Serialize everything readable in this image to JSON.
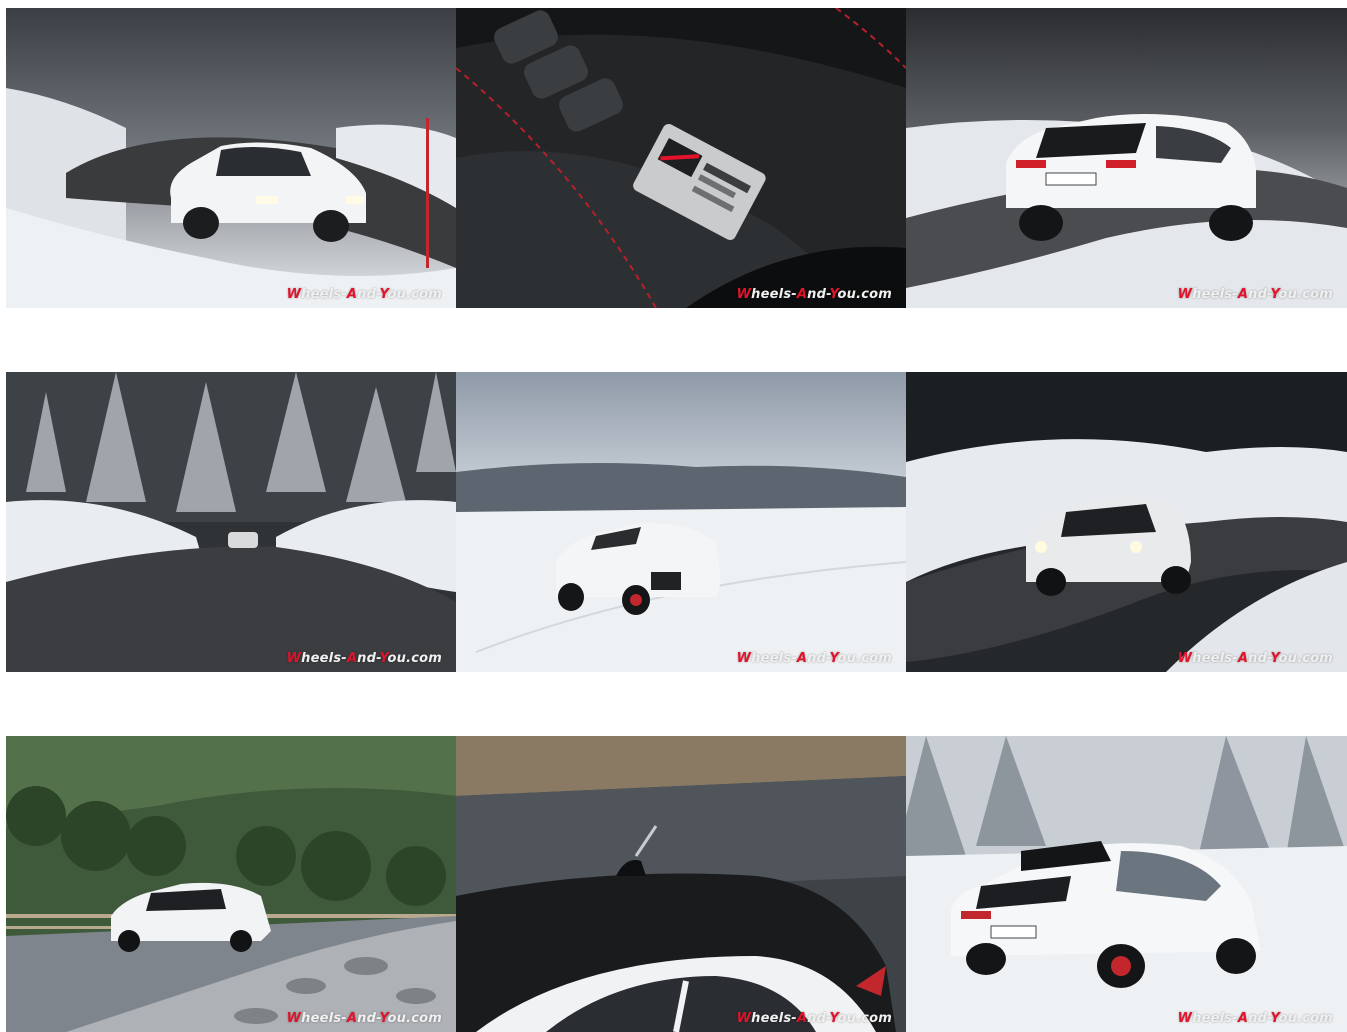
{
  "gallery": {
    "items": [
      {
        "scene": "white-hatchback-snowy-curve-fog",
        "watermark": {
          "a": "W",
          "b": "heels-",
          "c": "A",
          "d": "nd-",
          "e": "Y",
          "f": "ou.com"
        }
      },
      {
        "scene": "gr-wrc-interior-badge-closeup",
        "watermark": {
          "a": "W",
          "b": "heels-",
          "c": "A",
          "d": "nd-",
          "e": "Y",
          "f": "ou.com"
        }
      },
      {
        "scene": "white-hatchback-rear-snowy-road",
        "watermark": {
          "a": "W",
          "b": "heels-",
          "c": "A",
          "d": "nd-",
          "e": "Y",
          "f": "ou.com"
        }
      },
      {
        "scene": "snowy-forest-road-distant-car",
        "watermark": {
          "a": "W",
          "b": "heels-",
          "c": "A",
          "d": "nd-",
          "e": "Y",
          "f": "ou.com"
        }
      },
      {
        "scene": "white-hatchback-snowfield",
        "watermark": {
          "a": "W",
          "b": "heels-",
          "c": "A",
          "d": "nd-",
          "e": "Y",
          "f": "ou.com"
        }
      },
      {
        "scene": "white-hatchback-headlights-snow-bend",
        "watermark": {
          "a": "W",
          "b": "heels-",
          "c": "A",
          "d": "nd-",
          "e": "Y",
          "f": "ou.com"
        }
      },
      {
        "scene": "white-hatchback-mountain-road-wall",
        "watermark": {
          "a": "W",
          "b": "heels-",
          "c": "A",
          "d": "nd-",
          "e": "Y",
          "f": "ou.com"
        }
      },
      {
        "scene": "roof-and-window-closeup-road",
        "watermark": {
          "a": "W",
          "b": "heels-",
          "c": "A",
          "d": "nd-",
          "e": "Y",
          "f": "ou.com"
        }
      },
      {
        "scene": "white-hatchback-rear-snowy-trees",
        "watermark": {
          "a": "W",
          "b": "heels-",
          "c": "A",
          "d": "nd-",
          "e": "Y",
          "f": "ou.com"
        }
      }
    ]
  },
  "colors": {
    "watermark_red": "#e2132a",
    "watermark_white": "#f0f0f0",
    "background": "#ffffff"
  }
}
